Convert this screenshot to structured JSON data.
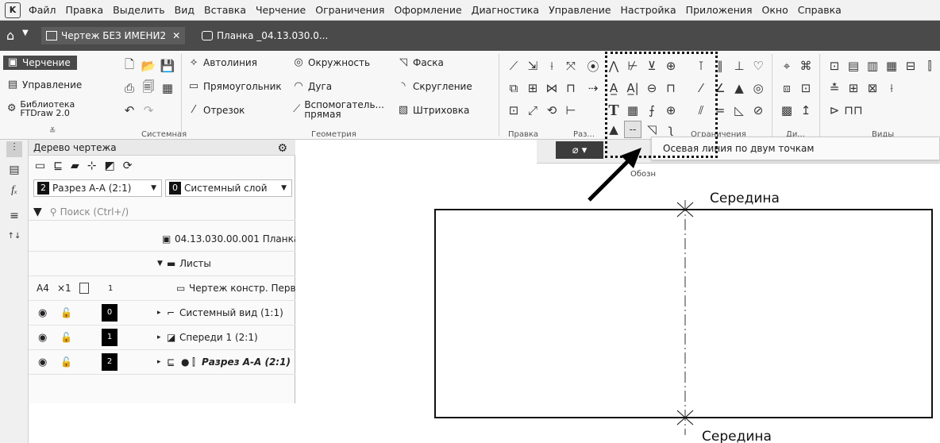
{
  "menu": [
    "Файл",
    "Правка",
    "Выделить",
    "Вид",
    "Вставка",
    "Черчение",
    "Ограничения",
    "Оформление",
    "Диагностика",
    "Управление",
    "Настройка",
    "Приложения",
    "Окно",
    "Справка"
  ],
  "tabs": [
    {
      "label": "Чертеж БЕЗ ИМЕНИ2",
      "active": true
    },
    {
      "label": "Планка _04.13.030.0...",
      "active": false
    }
  ],
  "ribbon": {
    "left_items": [
      "Черчение",
      "Управление",
      "Библиотека FTDraw 2.0"
    ],
    "geometry_items": [
      "Автолиния",
      "Прямоугольник",
      "Отрезок",
      "Окружность",
      "Дуга",
      "Вспомогатель... прямая",
      "Фаска",
      "Скругление",
      "Штриховка"
    ],
    "group_labels": [
      "Системная",
      "Геометрия",
      "Правка",
      "Раз...",
      "Ограничения",
      "Ди...",
      "Виды"
    ]
  },
  "tree": {
    "title": "Дерево чертежа",
    "view_combo": {
      "num": "2",
      "label": "Разрез А-А (2:1)"
    },
    "layer_combo": {
      "num": "0",
      "label": "Системный слой"
    },
    "search_placeholder": "Поиск (Ctrl+/)",
    "doc": "04.13.030.00.001 Планка",
    "sheets": "Листы",
    "sheet_row": {
      "format": "А4",
      "mult": "×1",
      "num": "1",
      "label": "Чертеж констр. Перв"
    },
    "views": [
      {
        "num": "0",
        "label": "Системный вид (1:1)"
      },
      {
        "num": "1",
        "label": "Спереди 1 (2:1)"
      },
      {
        "num": "2",
        "label": "Разрез А-А (2:1)"
      }
    ]
  },
  "tooltip": "Осевая линия по двум точкам",
  "float_label": "Обозн",
  "snap_top": "Середина",
  "snap_bottom": "Середина",
  "colors": {
    "tab_bar": "#4a4a4a",
    "ribbon": "#f7f7f7"
  }
}
